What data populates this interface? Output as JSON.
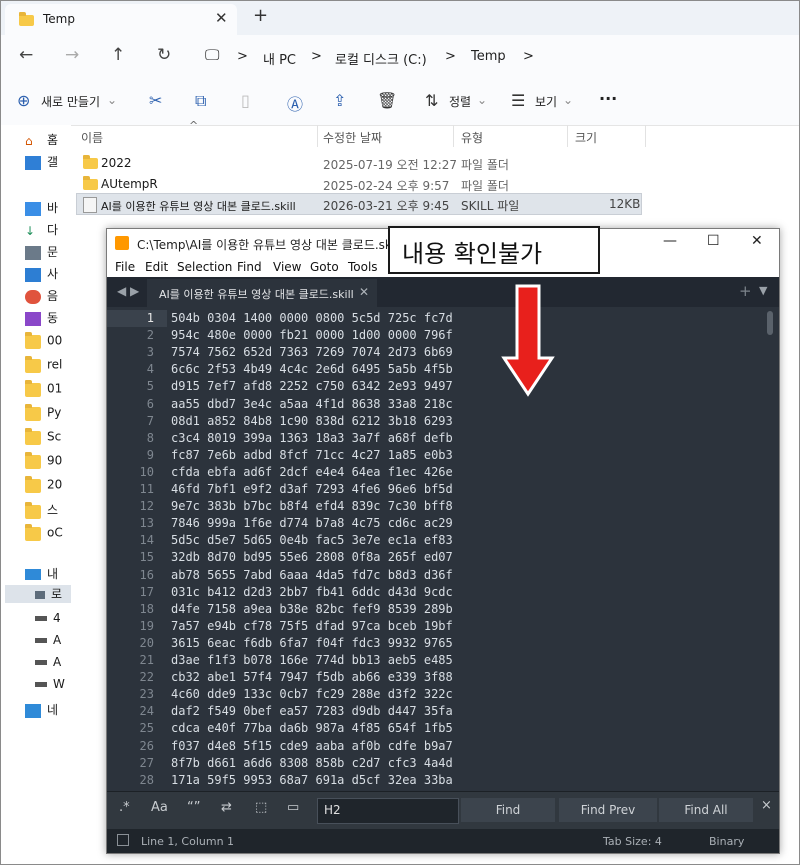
{
  "explorer": {
    "tab_title": "Temp",
    "breadcrumb": [
      "내 PC",
      "로컬 디스크 (C:)",
      "Temp"
    ],
    "commands": {
      "new": "새로 만들기",
      "sort": "정렬",
      "view": "보기",
      "more": "···"
    },
    "sidebar": [
      "홈",
      "갤",
      "바",
      "다",
      "문",
      "사",
      "음",
      "동",
      "00",
      "rel",
      "01",
      "Py",
      "Sc",
      "90",
      "20",
      "스",
      "oC",
      "내",
      "로",
      "4",
      "A",
      "A",
      "W",
      "네"
    ],
    "columns": {
      "name": "이름",
      "modified": "수정한 날짜",
      "type": "유형",
      "size": "크기"
    },
    "files": [
      {
        "name": "2022",
        "modified": "2025-07-19 오전 12:27",
        "type": "파일 폴더",
        "size": ""
      },
      {
        "name": "AUtempR",
        "modified": "2025-02-24 오후 9:57",
        "type": "파일 폴더",
        "size": ""
      },
      {
        "name": "AI를 이용한 유튜브 영상 대본 클로드.skill",
        "modified": "2026-03-21 오후 9:45",
        "type": "SKILL 파일",
        "size": "12KB"
      }
    ]
  },
  "sublime": {
    "title": "C:\\Temp\\AI를 이용한 유튜브 영상 대본 클로드.skill",
    "menu": [
      "File",
      "Edit",
      "Selection",
      "Find",
      "View",
      "Goto",
      "Tools"
    ],
    "tab": "AI를 이용한 유튜브 영상 대본 클로드.skill",
    "lines": [
      "504b 0304 1400 0000 0800 5c5d 725c fc7d",
      "954c 480e 0000 fb21 0000 1d00 0000 796f",
      "7574 7562 652d 7363 7269 7074 2d73 6b69",
      "6c6c 2f53 4b49 4c4c 2e6d 6495 5a5b 4f5b",
      "d915 7ef7 afd8 2252 c750 6342 2e93 9497",
      "aa55 dbd7 3e4c a5aa 4f1d 8638 33a8 218c",
      "08d1 a852 84b8 1c90 838d 6212 3b18 6293",
      "c3c4 8019 399a 1363 18a3 3a7f a68f defb",
      "fc87 7e6b adbd 8fcf 71cc 4c27 1a85 e0b3",
      "cfda ebfa ad6f 2dcf e4e4 64ea f1ec 426e",
      "46fd 7bf1 e9f2 d3af 7293 4fe6 96e6 bf5d",
      "9e7c 383b b7bc b8f4 efd4 839c 7c30 bff8",
      "7846 999a 1f6e d774 b7a8 4c75 cd6c ac29",
      "5d5c d5e7 5d65 0e4b fac5 3e7e ec1a ef83",
      "32db 8d70 bd95 55e6 2808 0f8a 265f ed07",
      "ab78 5655 7abd 6aaa 4da5 fd7c b8d3 d36f",
      "031c b412 d2d3 2bb7 fb41 6ddc d43d 9cdc",
      "d4fe 7158 a9ea b38e 82bc fef9 8539 289b",
      "7a57 e94b cf78 75f5 dfad 97ca bceb 19bf",
      "3615 6eac f6db 6fa7 f04f fdc3 9932 9765",
      "d3ae f1f3 b078 166e 774d bb13 aeb5 e485",
      "cb32 abe1 57f4 7947 f5db ab66 e339 3f88",
      "4c60 dde9 133c 0cb7 fc29 288e d3f2 322c",
      "daf2 f549 0bef ea57 7283 d9db d447 35fa",
      "cdca e40f 77ba da6b 987a 4f85 654f 1fb5",
      "f037 d4e8 5f15 cde9 aaba af0b cdfe b9a7",
      "8f7b d661 a6d6 8308 858b c2d7 cfc3 4a4d",
      "171a 59f5 9953 68a7 691a d5cf 32ea 33ba"
    ],
    "find": {
      "regex": ".*",
      "case": "Aa",
      "word": "“”",
      "value": "H2",
      "find": "Find",
      "find_prev": "Find Prev",
      "find_all": "Find All",
      "close": "×"
    },
    "status": {
      "position": "Line 1, Column 1",
      "tab_size": "Tab Size: 4",
      "encoding": "Binary"
    }
  },
  "annotation": {
    "text": "내용 확인불가",
    "color": "#e8201c"
  }
}
